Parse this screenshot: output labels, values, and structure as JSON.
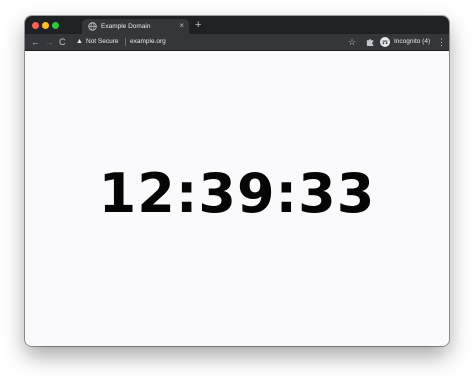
{
  "browser": {
    "tab": {
      "title": "Example Domain",
      "close_glyph": "×",
      "favicon": "globe-icon"
    },
    "new_tab_glyph": "+",
    "nav": {
      "back_glyph": "←",
      "forward_glyph": "→",
      "reload_glyph": "C"
    },
    "omnibox": {
      "security_icon": "warning-triangle-icon",
      "security_glyph": "▲",
      "security_label": "Not Secure",
      "url": "example.org"
    },
    "toolbar": {
      "bookmark_glyph": "☆",
      "extensions_icon": "puzzle-icon",
      "profile_icon": "incognito-icon",
      "profile_label": "Incognito (4)",
      "menu_glyph": "⋮"
    },
    "colors": {
      "tabstrip": "#202124",
      "toolbar": "#35363a",
      "page_background": "#fafafd",
      "clock_text": "#050505"
    }
  },
  "page": {
    "clock_time": "12:39:33"
  }
}
